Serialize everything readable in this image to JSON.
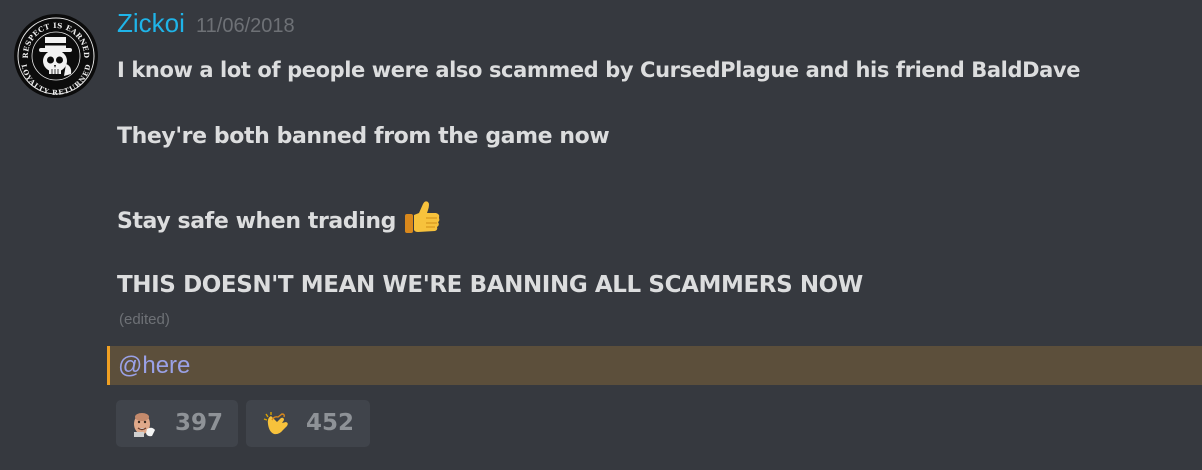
{
  "message": {
    "author": "Zickoi",
    "timestamp": "11/06/2018",
    "avatar": {
      "icon": "skull-top-hat-logo",
      "text_top": "RESPECT IS EARNED",
      "text_bottom": "LOYALTY RETURNED"
    },
    "lines": [
      "I know a lot of people were also scammed by CursedPlague and his friend BaldDave",
      "They're both banned from the game now",
      "Stay safe when trading",
      "THIS DOESN'T MEAN WE'RE BANNING ALL SCAMMERS NOW"
    ],
    "line3_emoji": "thumbs-up-emoji",
    "edited_label": "(edited)",
    "mention": "@here"
  },
  "reactions": [
    {
      "emoji": "custom-face-emoji",
      "count": "397"
    },
    {
      "emoji": "clapping-hands-emoji",
      "count": "452"
    }
  ],
  "colors": {
    "background": "#36393f",
    "username": "#1fb4e8",
    "text": "#dcddde",
    "muted": "#6e7176",
    "mention_highlight": "#5c4f3b",
    "mention_bar": "#f0a023",
    "mention_text": "#9aa1e6",
    "reaction_bg": "#40444b"
  }
}
